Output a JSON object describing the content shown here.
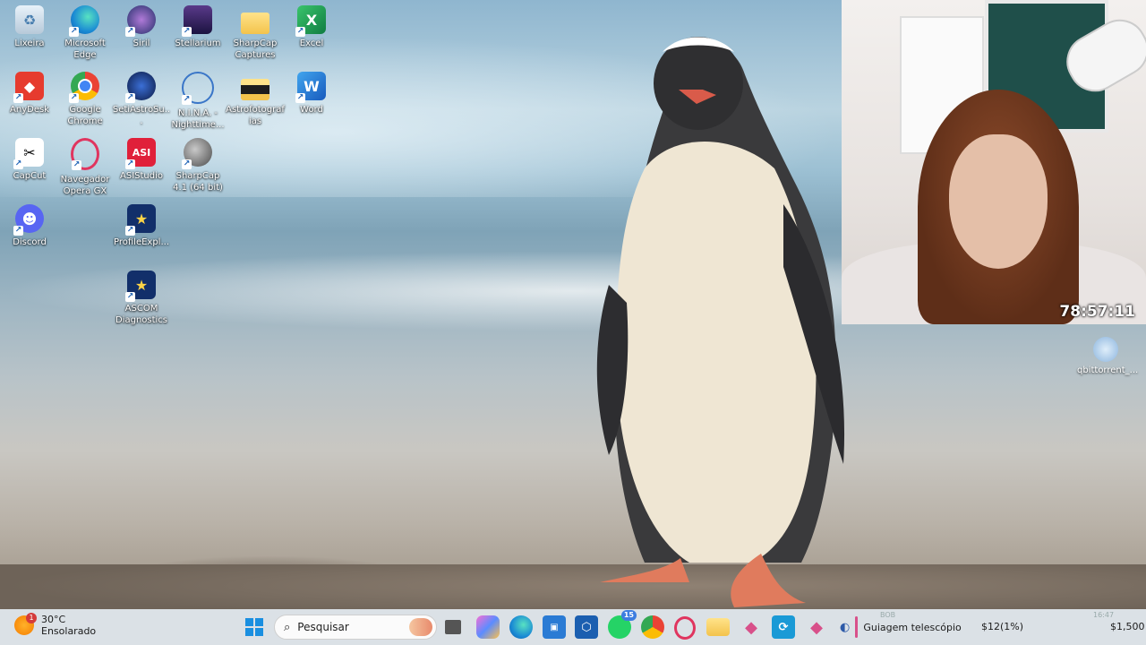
{
  "desktop": {
    "icons": [
      {
        "label": "Lixeira",
        "icon": "recycle-bin-icon"
      },
      {
        "label": "Microsoft Edge",
        "icon": "edge-icon"
      },
      {
        "label": "Siril",
        "icon": "siril-icon"
      },
      {
        "label": "Stellarium",
        "icon": "stellarium-icon"
      },
      {
        "label": "SharpCap Captures",
        "icon": "folder-icon"
      },
      {
        "label": "Excel",
        "icon": "excel-icon"
      },
      {
        "label": "AnyDesk",
        "icon": "anydesk-icon"
      },
      {
        "label": "Google Chrome",
        "icon": "chrome-icon"
      },
      {
        "label": "SetiAstroSu...",
        "icon": "setiastro-icon"
      },
      {
        "label": "N.I.N.A. - Nighttime...",
        "icon": "nina-icon"
      },
      {
        "label": "Astrofotografias",
        "icon": "folder-icon"
      },
      {
        "label": "Word",
        "icon": "word-icon"
      },
      {
        "label": "CapCut",
        "icon": "capcut-icon"
      },
      {
        "label": "Navegador Opera GX",
        "icon": "opera-gx-icon"
      },
      {
        "label": "ASIStudio",
        "icon": "asistudio-icon"
      },
      {
        "label": "SharpCap 4.1 (64 bit)",
        "icon": "sharpcap-icon"
      },
      {
        "label": "Discord",
        "icon": "discord-icon"
      },
      {
        "label": "ProfileExpl...",
        "icon": "ascom-profile-icon"
      },
      {
        "label": "ASCOM Diagnostics",
        "icon": "ascom-diagnostics-icon"
      }
    ],
    "right_icon": {
      "label": "qbittorrent_...",
      "icon": "qbittorrent-icon"
    }
  },
  "webcam": {
    "timer": "78:57:11"
  },
  "taskbar": {
    "weather": {
      "temp": "30°C",
      "condition": "Ensolarado",
      "badge": "1"
    },
    "search_placeholder": "Pesquisar",
    "whatsapp_badge": "15",
    "active_window_label": "Guiagem telescópio",
    "stock1": "$12(1%)",
    "stock2": "$1,500",
    "faint_texts": [
      "BOB",
      "16:47"
    ]
  },
  "colors": {
    "taskbar_bg": "#e1e4e8",
    "accent_pink": "#d8508a"
  }
}
